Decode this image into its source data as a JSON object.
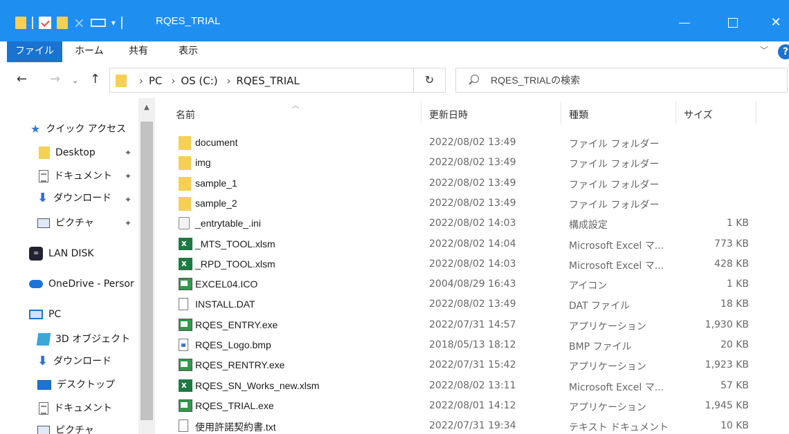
{
  "window": {
    "title": "RQES_TRIAL"
  },
  "window_controls": {
    "minimize": "",
    "maximize": "",
    "close": "✕"
  },
  "ribbon": {
    "tabs": [
      {
        "label": "ファイル",
        "active": true
      },
      {
        "label": "ホーム"
      },
      {
        "label": "共有"
      },
      {
        "label": "表示"
      }
    ],
    "help": "?"
  },
  "address": {
    "crumbs": [
      "PC",
      "OS (C:)",
      "RQES_TRIAL"
    ],
    "separator": "›"
  },
  "search": {
    "placeholder": "RQES_TRIALの検索"
  },
  "sidebar": {
    "items": [
      {
        "label": "クイック アクセス",
        "icon": "star-icon"
      },
      {
        "label": "Desktop",
        "icon": "folder-icon",
        "pinned": true
      },
      {
        "label": "ドキュメント",
        "icon": "document-icon",
        "pinned": true
      },
      {
        "label": "ダウンロード",
        "icon": "download-icon",
        "pinned": true
      },
      {
        "label": "ピクチャ",
        "icon": "pictures-icon",
        "pinned": true
      },
      {
        "label": "LAN DISK",
        "icon": "lan-disk-icon"
      },
      {
        "label": "OneDrive - Persor",
        "icon": "onedrive-icon"
      },
      {
        "label": "PC",
        "icon": "pc-icon"
      },
      {
        "label": "3D オブジェクト",
        "icon": "3d-objects-icon"
      },
      {
        "label": "ダウンロード",
        "icon": "download-icon"
      },
      {
        "label": "デスクトップ",
        "icon": "desktop-icon"
      },
      {
        "label": "ドキュメント",
        "icon": "document-icon"
      },
      {
        "label": "ピクチャ",
        "icon": "pictures-icon"
      }
    ]
  },
  "columns": {
    "name": "名前",
    "date": "更新日時",
    "type": "種類",
    "size": "サイズ"
  },
  "files": [
    {
      "name": "document",
      "date": "2022/08/02 13:49",
      "type": "ファイル フォルダー",
      "size": "",
      "icon": "folder-icon"
    },
    {
      "name": "img",
      "date": "2022/08/02 13:49",
      "type": "ファイル フォルダー",
      "size": "",
      "icon": "folder-icon"
    },
    {
      "name": "sample_1",
      "date": "2022/08/02 13:49",
      "type": "ファイル フォルダー",
      "size": "",
      "icon": "folder-icon"
    },
    {
      "name": "sample_2",
      "date": "2022/08/02 13:49",
      "type": "ファイル フォルダー",
      "size": "",
      "icon": "folder-icon"
    },
    {
      "name": "_entrytable_.ini",
      "date": "2022/08/02 14:03",
      "type": "構成設定",
      "size": "1 KB",
      "icon": "settings-file-icon"
    },
    {
      "name": "_MTS_TOOL.xlsm",
      "date": "2022/08/02 14:04",
      "type": "Microsoft Excel マ...",
      "size": "773 KB",
      "icon": "excel-macro-icon"
    },
    {
      "name": "_RPD_TOOL.xlsm",
      "date": "2022/08/02 14:03",
      "type": "Microsoft Excel マ...",
      "size": "428 KB",
      "icon": "excel-macro-icon"
    },
    {
      "name": "EXCEL04.ICO",
      "date": "2004/08/29 16:43",
      "type": "アイコン",
      "size": "1 KB",
      "icon": "ico-file-icon"
    },
    {
      "name": "INSTALL.DAT",
      "date": "2022/08/02 13:49",
      "type": "DAT ファイル",
      "size": "18 KB",
      "icon": "blank-file-icon"
    },
    {
      "name": "RQES_ENTRY.exe",
      "date": "2022/07/31 14:57",
      "type": "アプリケーション",
      "size": "1,930 KB",
      "icon": "exe-icon"
    },
    {
      "name": "RQES_Logo.bmp",
      "date": "2018/05/13 18:12",
      "type": "BMP ファイル",
      "size": "20 KB",
      "icon": "bmp-icon"
    },
    {
      "name": "RQES_RENTRY.exe",
      "date": "2022/07/31 15:42",
      "type": "アプリケーション",
      "size": "1,923 KB",
      "icon": "exe-icon"
    },
    {
      "name": "RQES_SN_Works_new.xlsm",
      "date": "2022/08/02 13:11",
      "type": "Microsoft Excel マ...",
      "size": "57 KB",
      "icon": "excel-macro-icon"
    },
    {
      "name": "RQES_TRIAL.exe",
      "date": "2022/08/01 14:12",
      "type": "アプリケーション",
      "size": "1,945 KB",
      "icon": "exe-icon"
    },
    {
      "name": "使用許諾契約書.txt",
      "date": "2022/07/31 19:34",
      "type": "テキスト ドキュメント",
      "size": "10 KB",
      "icon": "text-file-icon"
    }
  ]
}
